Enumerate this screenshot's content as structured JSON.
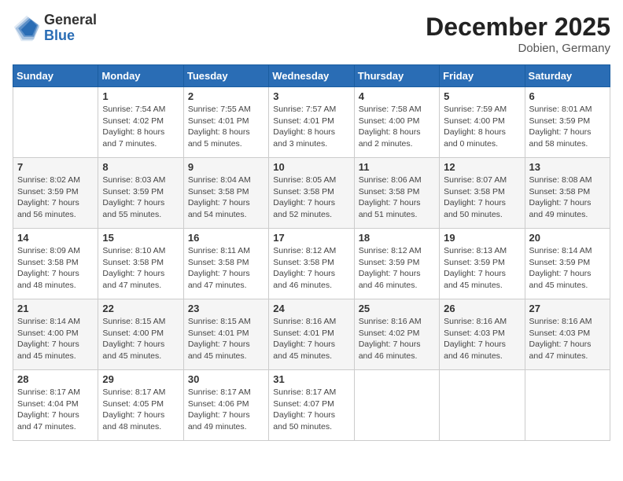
{
  "header": {
    "logo_general": "General",
    "logo_blue": "Blue",
    "month_year": "December 2025",
    "location": "Dobien, Germany"
  },
  "days_of_week": [
    "Sunday",
    "Monday",
    "Tuesday",
    "Wednesday",
    "Thursday",
    "Friday",
    "Saturday"
  ],
  "weeks": [
    [
      {
        "day": "",
        "info": ""
      },
      {
        "day": "1",
        "info": "Sunrise: 7:54 AM\nSunset: 4:02 PM\nDaylight: 8 hours\nand 7 minutes."
      },
      {
        "day": "2",
        "info": "Sunrise: 7:55 AM\nSunset: 4:01 PM\nDaylight: 8 hours\nand 5 minutes."
      },
      {
        "day": "3",
        "info": "Sunrise: 7:57 AM\nSunset: 4:01 PM\nDaylight: 8 hours\nand 3 minutes."
      },
      {
        "day": "4",
        "info": "Sunrise: 7:58 AM\nSunset: 4:00 PM\nDaylight: 8 hours\nand 2 minutes."
      },
      {
        "day": "5",
        "info": "Sunrise: 7:59 AM\nSunset: 4:00 PM\nDaylight: 8 hours\nand 0 minutes."
      },
      {
        "day": "6",
        "info": "Sunrise: 8:01 AM\nSunset: 3:59 PM\nDaylight: 7 hours\nand 58 minutes."
      }
    ],
    [
      {
        "day": "7",
        "info": "Sunrise: 8:02 AM\nSunset: 3:59 PM\nDaylight: 7 hours\nand 56 minutes."
      },
      {
        "day": "8",
        "info": "Sunrise: 8:03 AM\nSunset: 3:59 PM\nDaylight: 7 hours\nand 55 minutes."
      },
      {
        "day": "9",
        "info": "Sunrise: 8:04 AM\nSunset: 3:58 PM\nDaylight: 7 hours\nand 54 minutes."
      },
      {
        "day": "10",
        "info": "Sunrise: 8:05 AM\nSunset: 3:58 PM\nDaylight: 7 hours\nand 52 minutes."
      },
      {
        "day": "11",
        "info": "Sunrise: 8:06 AM\nSunset: 3:58 PM\nDaylight: 7 hours\nand 51 minutes."
      },
      {
        "day": "12",
        "info": "Sunrise: 8:07 AM\nSunset: 3:58 PM\nDaylight: 7 hours\nand 50 minutes."
      },
      {
        "day": "13",
        "info": "Sunrise: 8:08 AM\nSunset: 3:58 PM\nDaylight: 7 hours\nand 49 minutes."
      }
    ],
    [
      {
        "day": "14",
        "info": "Sunrise: 8:09 AM\nSunset: 3:58 PM\nDaylight: 7 hours\nand 48 minutes."
      },
      {
        "day": "15",
        "info": "Sunrise: 8:10 AM\nSunset: 3:58 PM\nDaylight: 7 hours\nand 47 minutes."
      },
      {
        "day": "16",
        "info": "Sunrise: 8:11 AM\nSunset: 3:58 PM\nDaylight: 7 hours\nand 47 minutes."
      },
      {
        "day": "17",
        "info": "Sunrise: 8:12 AM\nSunset: 3:58 PM\nDaylight: 7 hours\nand 46 minutes."
      },
      {
        "day": "18",
        "info": "Sunrise: 8:12 AM\nSunset: 3:59 PM\nDaylight: 7 hours\nand 46 minutes."
      },
      {
        "day": "19",
        "info": "Sunrise: 8:13 AM\nSunset: 3:59 PM\nDaylight: 7 hours\nand 45 minutes."
      },
      {
        "day": "20",
        "info": "Sunrise: 8:14 AM\nSunset: 3:59 PM\nDaylight: 7 hours\nand 45 minutes."
      }
    ],
    [
      {
        "day": "21",
        "info": "Sunrise: 8:14 AM\nSunset: 4:00 PM\nDaylight: 7 hours\nand 45 minutes."
      },
      {
        "day": "22",
        "info": "Sunrise: 8:15 AM\nSunset: 4:00 PM\nDaylight: 7 hours\nand 45 minutes."
      },
      {
        "day": "23",
        "info": "Sunrise: 8:15 AM\nSunset: 4:01 PM\nDaylight: 7 hours\nand 45 minutes."
      },
      {
        "day": "24",
        "info": "Sunrise: 8:16 AM\nSunset: 4:01 PM\nDaylight: 7 hours\nand 45 minutes."
      },
      {
        "day": "25",
        "info": "Sunrise: 8:16 AM\nSunset: 4:02 PM\nDaylight: 7 hours\nand 46 minutes."
      },
      {
        "day": "26",
        "info": "Sunrise: 8:16 AM\nSunset: 4:03 PM\nDaylight: 7 hours\nand 46 minutes."
      },
      {
        "day": "27",
        "info": "Sunrise: 8:16 AM\nSunset: 4:03 PM\nDaylight: 7 hours\nand 47 minutes."
      }
    ],
    [
      {
        "day": "28",
        "info": "Sunrise: 8:17 AM\nSunset: 4:04 PM\nDaylight: 7 hours\nand 47 minutes."
      },
      {
        "day": "29",
        "info": "Sunrise: 8:17 AM\nSunset: 4:05 PM\nDaylight: 7 hours\nand 48 minutes."
      },
      {
        "day": "30",
        "info": "Sunrise: 8:17 AM\nSunset: 4:06 PM\nDaylight: 7 hours\nand 49 minutes."
      },
      {
        "day": "31",
        "info": "Sunrise: 8:17 AM\nSunset: 4:07 PM\nDaylight: 7 hours\nand 50 minutes."
      },
      {
        "day": "",
        "info": ""
      },
      {
        "day": "",
        "info": ""
      },
      {
        "day": "",
        "info": ""
      }
    ]
  ]
}
